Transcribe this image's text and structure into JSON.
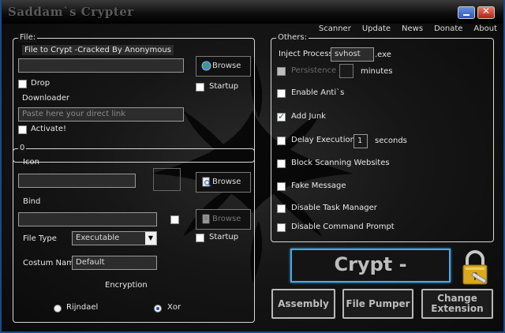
{
  "window": {
    "title": "Saddam`s Crypter"
  },
  "menu": [
    "Scanner",
    "Update",
    "News",
    "Donate",
    "About"
  ],
  "file_group": {
    "legend": "File:",
    "crypt_label": "File to Crypt -Cracked By Anonymous",
    "file_path_value": "",
    "browse_label": "Browse",
    "startup_label": "Startup",
    "drop_label": "Drop",
    "downloader_label": "Downloader",
    "link_placeholder": "Paste here your direct link",
    "activate_label": "Activate!"
  },
  "options_group": {
    "legend": "0",
    "icon_label": "Icon",
    "icon_path_value": "",
    "icon_browse_label": "Browse",
    "bind_label": "Bind",
    "bind_path_value": "",
    "bind_browse_label": "Browse",
    "startup_label": "Startup",
    "file_type_label": "File Type",
    "file_type_value": "Executable",
    "custom_name_label": "Costum Name",
    "custom_name_value": "Default",
    "encryption_label": "Encryption",
    "rijndael_label": "Rijndael",
    "xor_label": "Xor",
    "selected_encryption": "Xor"
  },
  "others_group": {
    "legend": "Others:",
    "inject_label": "Inject Process",
    "inject_value": "svhost",
    "inject_ext": ".exe",
    "persistence_label": "Persistence",
    "persistence_value": "",
    "minutes_label": "minutes",
    "enable_antis_label": "Enable Anti`s",
    "add_junk_label": "Add Junk",
    "delay_label": "Delay Execution",
    "delay_value": "1",
    "seconds_label": "seconds",
    "block_scanning_label": "Block Scanning Websites",
    "fake_message_label": "Fake Message",
    "disable_taskmgr_label": "Disable Task Manager",
    "disable_cmd_label": "Disable Command Prompt"
  },
  "crypt_button": "Crypt -",
  "assembly_button": "Assembly",
  "file_pumper_button": "File Pumper",
  "change_extension_button_line1": "Change",
  "change_extension_button_line2": "Extension",
  "colors": {
    "accent": "#4aa8e8",
    "frame": "#1a4a8a",
    "background": "#151515"
  }
}
